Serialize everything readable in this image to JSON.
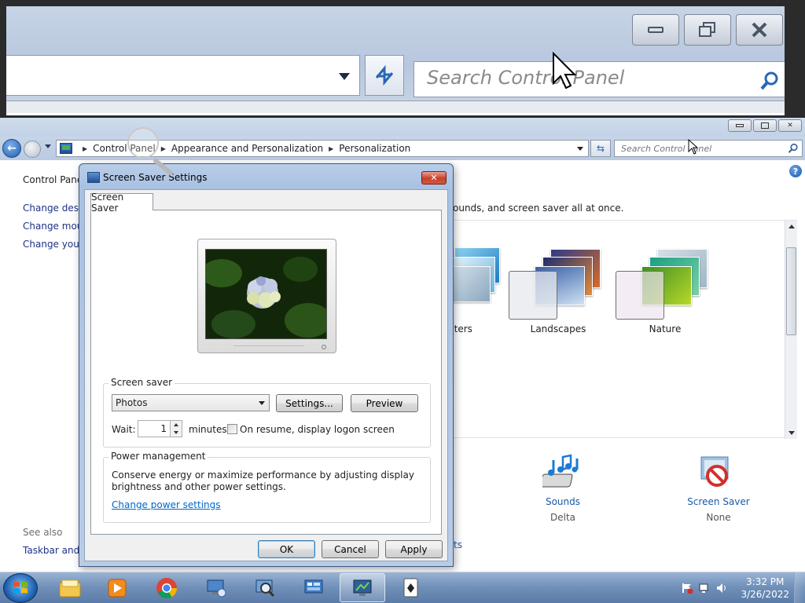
{
  "zoom_panel": {
    "search_placeholder": "Search Control Panel"
  },
  "window": {
    "breadcrumbs": [
      "Control Panel",
      "Appearance and Personalization",
      "Personalization"
    ],
    "search_placeholder": "Search Control Panel",
    "left_pane": {
      "home": "Control Panel Home",
      "links": [
        "Change desktop icons",
        "Change mouse pointers",
        "Change your account picture"
      ],
      "see_also_title": "See also",
      "see_also_links": [
        "Taskbar and Start Menu"
      ]
    },
    "intro_text": "ounds, and screen saver all at once.",
    "themes": [
      {
        "label": "cters"
      },
      {
        "label": "Landscapes"
      },
      {
        "label": "Nature"
      }
    ],
    "bottom_items": [
      {
        "label": "Sounds",
        "sub": "Delta"
      },
      {
        "label": "Screen Saver",
        "sub": "None"
      }
    ],
    "partial_link": "ts"
  },
  "dialog": {
    "title": "Screen Saver Settings",
    "tab": "Screen Saver",
    "screen_saver_group": "Screen saver",
    "screen_saver_value": "Photos",
    "settings_button": "Settings...",
    "preview_button": "Preview",
    "wait_label": "Wait:",
    "wait_value": "1",
    "minutes_label": "minutes",
    "resume_label": "On resume, display logon screen",
    "resume_checked": false,
    "power_group": "Power management",
    "power_text_1": "Conserve energy or maximize performance by adjusting display",
    "power_text_2": "brightness and other power settings.",
    "power_link": "Change power settings",
    "ok_button": "OK",
    "cancel_button": "Cancel",
    "apply_button": "Apply"
  },
  "taskbar": {
    "time": "3:32 PM",
    "date": "3/26/2022"
  },
  "colors": {
    "link": "#1e3287",
    "taskbar": "#6f8fb8",
    "close_red": "#c6402a"
  }
}
